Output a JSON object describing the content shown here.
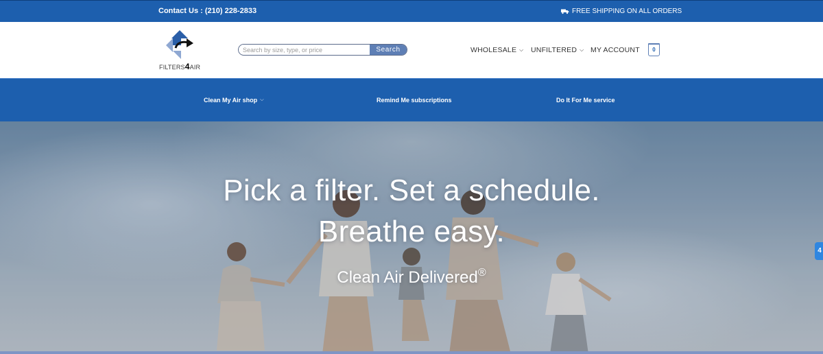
{
  "topbar": {
    "contact": "Contact Us : (210) 228-2833",
    "shipping": "FREE SHIPPING ON ALL ORDERS",
    "shipping_icon": "truck-icon"
  },
  "header": {
    "logo_text_a": "FILTERS",
    "logo_text_b": "4",
    "logo_text_c": "AIR",
    "search": {
      "placeholder": "Search by size, type, or price",
      "value": "",
      "button_label": "Search"
    },
    "nav": [
      {
        "label": "WHOLESALE",
        "has_dropdown": true
      },
      {
        "label": "UNFILTERED",
        "has_dropdown": true
      },
      {
        "label": "MY ACCOUNT",
        "has_dropdown": false
      }
    ],
    "cart_count": "0"
  },
  "subnav": [
    {
      "label": "Clean My Air shop",
      "has_dropdown": true
    },
    {
      "label": "Remind Me subscriptions",
      "has_dropdown": false
    },
    {
      "label": "Do It For Me service",
      "has_dropdown": false
    }
  ],
  "hero": {
    "headline_line1": "Pick a filter. Set a schedule.",
    "headline_line2": "Breathe easy.",
    "tagline": "Clean Air Delivered",
    "tagline_mark": "®"
  },
  "side_tab": "4",
  "colors": {
    "brand_blue": "#1d5fae",
    "search_button": "#5e7fb5",
    "logo_blue": "#2b5fa8",
    "logo_light": "#8fa8d2"
  }
}
